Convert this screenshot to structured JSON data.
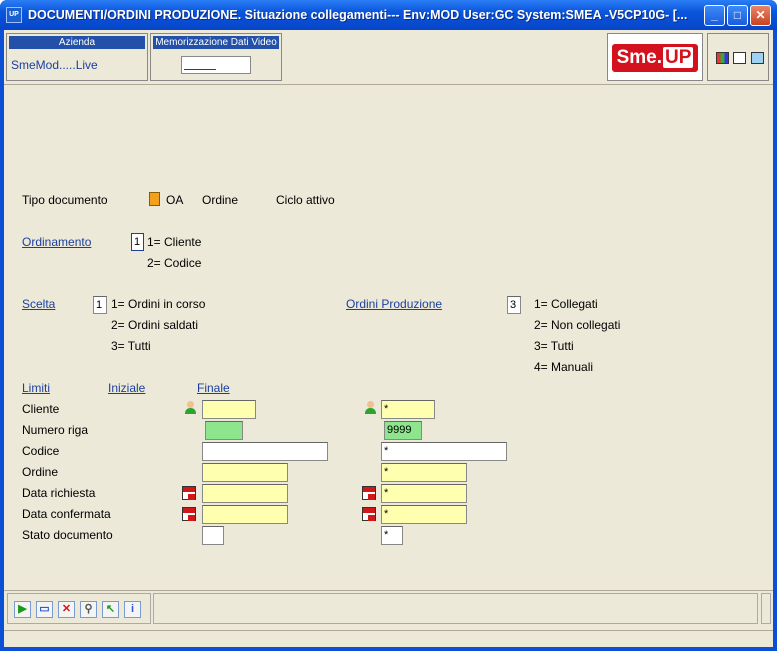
{
  "window": {
    "title": "DOCUMENTI/ORDINI PRODUZIONE.  Situazione collegamenti--- Env:MOD User:GC System:SMEA -V5CP10G- [...",
    "icon_text": "UP",
    "minimize": "_",
    "maximize": "□",
    "close": "✕"
  },
  "header": {
    "company_caption": "Azienda",
    "company_value": "SmeMod.....Live",
    "video_caption": "Memorizzazione Dati Video",
    "logo_sme": "Sme.",
    "logo_up": "UP"
  },
  "doc_type": {
    "label": "Tipo documento",
    "code": "OA",
    "desc": "Ordine",
    "cycle": "Ciclo attivo"
  },
  "ordering": {
    "label": "Ordinamento",
    "value": "1",
    "options": [
      "1=   Cliente",
      "2=   Codice"
    ]
  },
  "choice": {
    "label": "Scelta",
    "value": "1",
    "options": [
      "1=    Ordini in corso",
      "2=    Ordini saldati",
      "3=    Tutti"
    ]
  },
  "production_orders": {
    "label": "Ordini Produzione",
    "value": "3",
    "options": [
      "1=    Collegati",
      "2=    Non collegati",
      "3=    Tutti",
      "4= Manuali"
    ]
  },
  "limits": {
    "header_limits": "Limiti",
    "header_initial": "Iniziale",
    "header_final": "Finale",
    "rows": [
      {
        "label": "Cliente",
        "initial": "",
        "final": "*"
      },
      {
        "label": "Numero riga",
        "initial": "",
        "final": "9999"
      },
      {
        "label": "Codice",
        "initial": "",
        "final": "*"
      },
      {
        "label": "Ordine",
        "initial": "",
        "final": "*"
      },
      {
        "label": "Data richiesta",
        "initial": "",
        "final": "*"
      },
      {
        "label": "Data confermata",
        "initial": "",
        "final": "*"
      },
      {
        "label": "Stato documento",
        "initial": "",
        "final": "*"
      }
    ]
  },
  "toolbar": {
    "buttons": [
      "run-icon",
      "open-icon",
      "cancel-icon",
      "search-icon",
      "back-icon",
      "info-icon"
    ]
  },
  "colors": {
    "accent": "#1a3fa0",
    "yellow_field": "#ffffb0",
    "green_field": "#8de68d",
    "logo_red": "#d4121e"
  }
}
